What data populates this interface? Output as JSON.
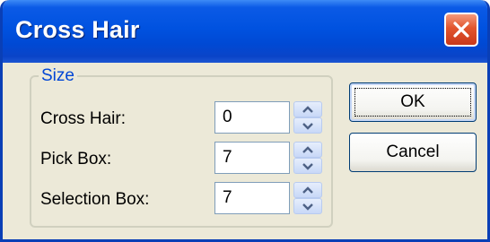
{
  "dialog": {
    "title": "Cross Hair",
    "close_icon": "close-x-icon"
  },
  "size_group": {
    "label": "Size",
    "fields": [
      {
        "label": "Cross Hair:",
        "value": "0"
      },
      {
        "label": "Pick Box:",
        "value": "7"
      },
      {
        "label": "Selection Box:",
        "value": "7"
      }
    ]
  },
  "buttons": {
    "ok": "OK",
    "cancel": "Cancel"
  },
  "colors": {
    "title_bar": "#0052e0",
    "close_button": "#e2552d",
    "group_label": "#0046d5",
    "dialog_background": "#ece9d8"
  }
}
